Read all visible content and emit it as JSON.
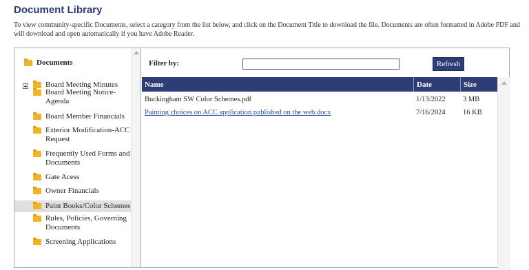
{
  "page": {
    "title": "Document Library",
    "intro": "To view community-specific Documents, select a category from the list below, and click on the Document Title to download the file.  Documents are often formatted in Adobe PDF and will download and open automatically if you have Adobe Reader."
  },
  "tree": {
    "root_label": "Documents",
    "selected_index": 7,
    "items": [
      {
        "label": "Board Meeting Minutes",
        "expandable": true
      },
      {
        "label": "Board Meeting Notice-Agenda"
      },
      {
        "label": "Board Member Financials"
      },
      {
        "label": "Exterior Modification-ACC Request"
      },
      {
        "label": "Frequently Used Forms and Documents"
      },
      {
        "label": "Gate Acess"
      },
      {
        "label": "Owner Financials"
      },
      {
        "label": "Paint Books/Color Schemes"
      },
      {
        "label": "Rules, Policies, Governing Documents"
      },
      {
        "label": "Screening Applications"
      }
    ]
  },
  "filter": {
    "label": "Filter by:",
    "value": "",
    "refresh_label": "Refresh"
  },
  "grid": {
    "columns": {
      "name": "Name",
      "date": "Date",
      "size": "Size"
    },
    "rows": [
      {
        "name": "Buckingham SW Color Schemes.pdf",
        "date": "1/13/2022",
        "size": "3 MB",
        "linked": false
      },
      {
        "name": "Painting choices on ACC application published on the web.docx",
        "date": "7/16/2024",
        "size": "16 KB",
        "linked": true
      }
    ]
  },
  "colors": {
    "title": "#2b3a7a",
    "header_bg": "#2e3d76",
    "folder": "#f0b429",
    "link": "#1f4fa0",
    "selected_bg": "#e0e0e0"
  },
  "icons": {
    "folder": "folder-icon",
    "expand": "expand-plus-icon",
    "scroll_up": "scroll-up-arrow-icon"
  }
}
